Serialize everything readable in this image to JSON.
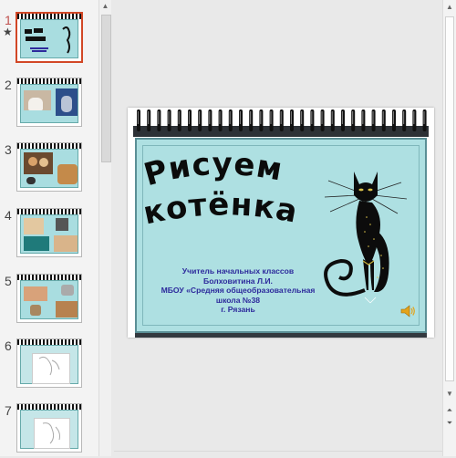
{
  "thumbnails": [
    {
      "number": "1",
      "active": true,
      "has_animation_star": true,
      "star": "★"
    },
    {
      "number": "2"
    },
    {
      "number": "3"
    },
    {
      "number": "4"
    },
    {
      "number": "5"
    },
    {
      "number": "6"
    },
    {
      "number": "7"
    }
  ],
  "slide": {
    "title_line1": "Рисуем",
    "title_line2": "котёнка",
    "teacher_lines": [
      "Учитель начальных классов",
      "Болховитина Л.И.",
      "МБОУ «Средняя общеобразовательная",
      "школа №38",
      "г. Рязань"
    ],
    "speaker_icon": "speaker-icon",
    "cat_image": "black-cat-drawing"
  },
  "colors": {
    "card_bg": "#aee0e2",
    "teacher_text": "#2d2a9c",
    "active_thumb_border": "#d24726",
    "active_number": "#c0504d"
  }
}
